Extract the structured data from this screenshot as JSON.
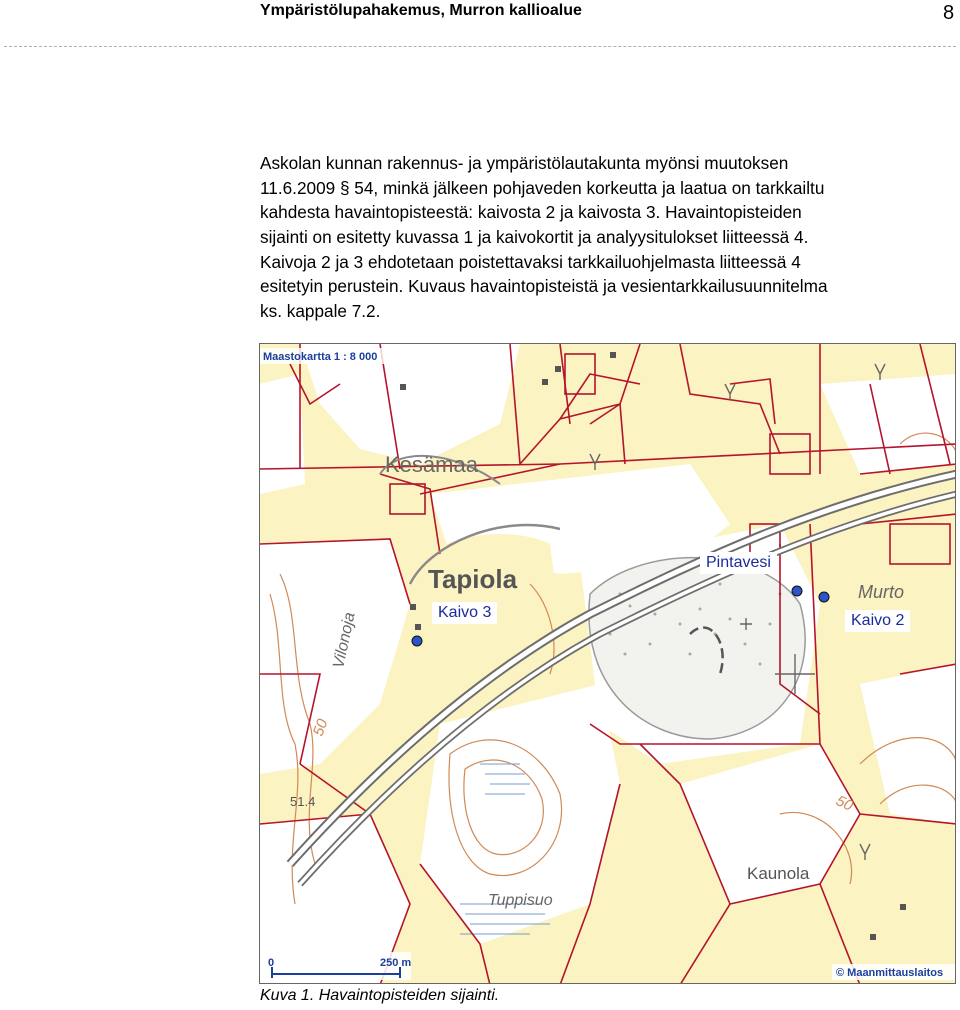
{
  "header": {
    "title": "Ympäristölupahakemus, Murron kallioalue",
    "page_number": "8"
  },
  "body": {
    "lines": [
      "Askolan kunnan rakennus- ja ympäristölautakunta myönsi muutoksen",
      "11.6.2009 § 54, minkä jälkeen pohjaveden korkeutta ja laatua on tarkkailtu",
      "kahdesta havaintopisteestä: kaivosta 2 ja kaivosta 3. Havaintopisteiden",
      "sijainti on esitetty kuvassa 1 ja kaivokortit ja analyysitulokset liitteessä 4.",
      "Kaivoja 2 ja 3 ehdotetaan poistettavaksi tarkkailuohjelmasta liitteessä 4",
      "esitetyin perustein. Kuvaus havaintopisteistä ja vesientarkkailusuunnitelma",
      "ks. kappale 7.2."
    ]
  },
  "map": {
    "scale_title": "Maastokartta 1 : 8 000",
    "place_names": {
      "kesamaa": "Kesämaa",
      "tapiola": "Tapiola",
      "murto": "Murto",
      "kaunola": "Kaunola",
      "tuppisuo": "Tuppisuo",
      "vilonoja": "Vilonoja"
    },
    "elevations": {
      "e50_left": "50",
      "e50_right": "50",
      "e514": "51.4"
    },
    "callouts": {
      "kaivo3": "Kaivo 3",
      "kaivo2": "Kaivo 2",
      "pintavesi": "Pintavesi"
    },
    "scale_bar": {
      "start": "0",
      "end": "250 m"
    },
    "copyright": "© Maanmittauslaitos",
    "colors": {
      "field": "#fbf3c1",
      "forest": "#ffffff",
      "border": "#b5142c",
      "road": "#8a8a8a",
      "point": "#2b55c8",
      "contour": "#d08a55"
    }
  },
  "caption": "Kuva 1. Havaintopisteiden sijainti."
}
